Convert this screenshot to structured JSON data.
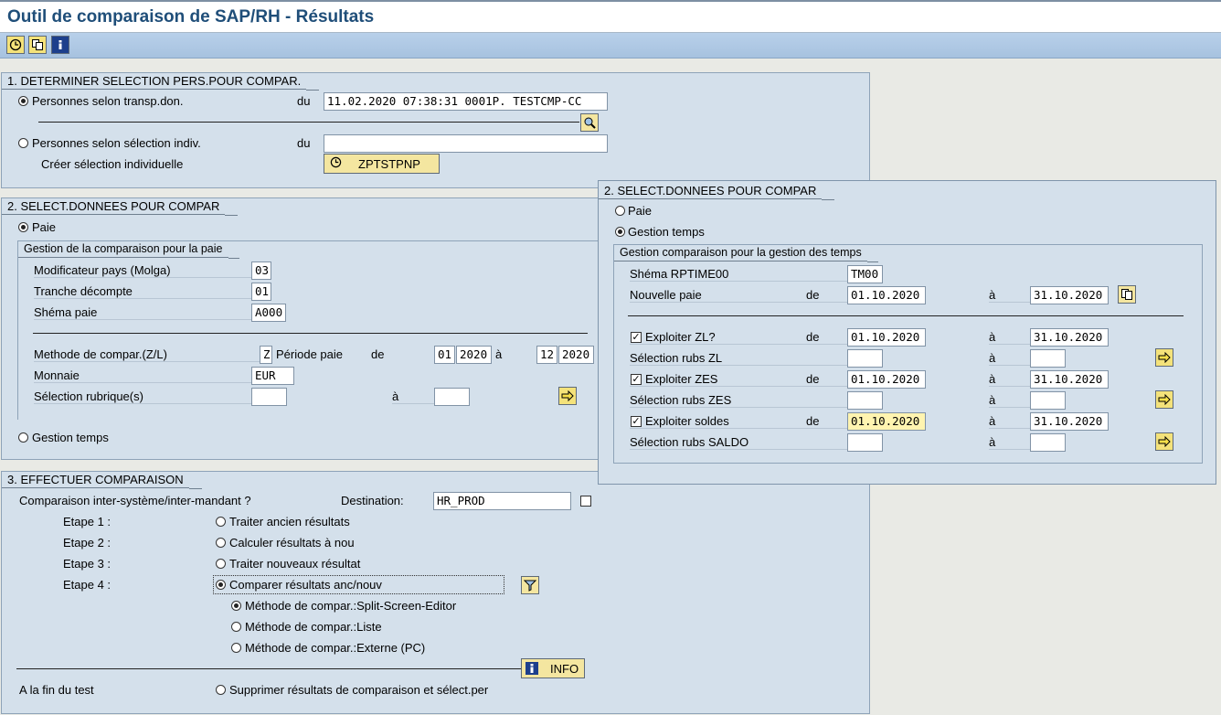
{
  "window": {
    "title": "Outil de comparaison de SAP/RH - Résultats"
  },
  "toolbar": {
    "icons": [
      "execute-icon",
      "copy-variant-icon",
      "info-icon"
    ]
  },
  "section1": {
    "title": "1. DETERMINER SELECTION PERS.POUR COMPAR.",
    "opt_transport": "Personnes selon transp.don.",
    "du": "du",
    "transport_value": "11.02.2020 07:38:31  0001P. TESTCMP-CC",
    "opt_indiv": "Personnes selon sélection indiv.",
    "indiv_value": "",
    "create_indiv_label": "Créer sélection individuelle",
    "create_btn": "ZPTSTPNP"
  },
  "section2": {
    "title": "2. SELECT.DONNEES POUR COMPAR",
    "opt_paie": "Paie",
    "group_title": "Gestion de la comparaison pour la paie",
    "molga_label": "Modificateur pays (Molga)",
    "molga_value": "03",
    "tranche_label": "Tranche décompte",
    "tranche_value": "01",
    "schema_label": "Shéma paie",
    "schema_value": "A000",
    "method_label": "Methode de compar.(Z/L)",
    "method_value": "Z",
    "period_label": "Période paie",
    "de": "de",
    "a": "à",
    "period_from_m": "01",
    "period_from_y": "2020",
    "period_to_m": "12",
    "period_to_y": "2020",
    "currency_label": "Monnaie",
    "currency_value": "EUR",
    "rubric_label": "Sélection rubrique(s)",
    "rubric_from": "",
    "rubric_to": "",
    "opt_temps": "Gestion temps"
  },
  "section2b": {
    "title": "2. SELECT.DONNEES POUR COMPAR",
    "opt_paie": "Paie",
    "opt_temps": "Gestion temps",
    "group_title": "Gestion comparaison pour la gestion des temps",
    "schema_label": "Shéma RPTIME00",
    "schema_value": "TM00",
    "payroll_label": "Nouvelle paie",
    "de": "de",
    "a": "à",
    "payroll_from": "01.10.2020",
    "payroll_to": "31.10.2020",
    "zl_label": "Exploiter ZL?",
    "zl_from": "01.10.2020",
    "zl_to": "31.10.2020",
    "zl_rubs_label": "Sélection rubs ZL",
    "zes_label": "Exploiter ZES",
    "zes_from": "01.10.2020",
    "zes_to": "31.10.2020",
    "zes_rubs_label": "Sélection rubs ZES",
    "soldes_label": "Exploiter soldes",
    "soldes_from": "01.10.2020",
    "soldes_to": "31.10.2020",
    "saldo_rubs_label": "Sélection rubs SALDO",
    "empty": ""
  },
  "section3": {
    "title": "3. EFFECTUER COMPARAISON",
    "inter_label": "Comparaison inter-système/inter-mandant ?",
    "dest_label": "Destination:",
    "dest_value": "HR_PROD",
    "step1": "Etape 1 :",
    "step1_opt": "Traiter ancien résultats",
    "step2": "Etape 2 :",
    "step2_opt": "Calculer résultats à nou",
    "step3": "Etape 3 :",
    "step3_opt": "Traiter nouveaux résultat",
    "step4": "Etape 4 :",
    "step4_opt": "Comparer résultats anc/nouv",
    "m1": "Méthode de compar.:Split-Screen-Editor",
    "m2": "Méthode de compar.:Liste",
    "m3": "Méthode de compar.:Externe (PC)",
    "info_btn": "INFO",
    "end_label": "A la fin du test",
    "end_opt": "Supprimer résultats de comparaison et sélect.per"
  },
  "colors": {
    "title": "#1f4e79",
    "panel": "#d4e0eb",
    "toolbar": "#b8d0ea",
    "button": "#f4e6a0"
  }
}
